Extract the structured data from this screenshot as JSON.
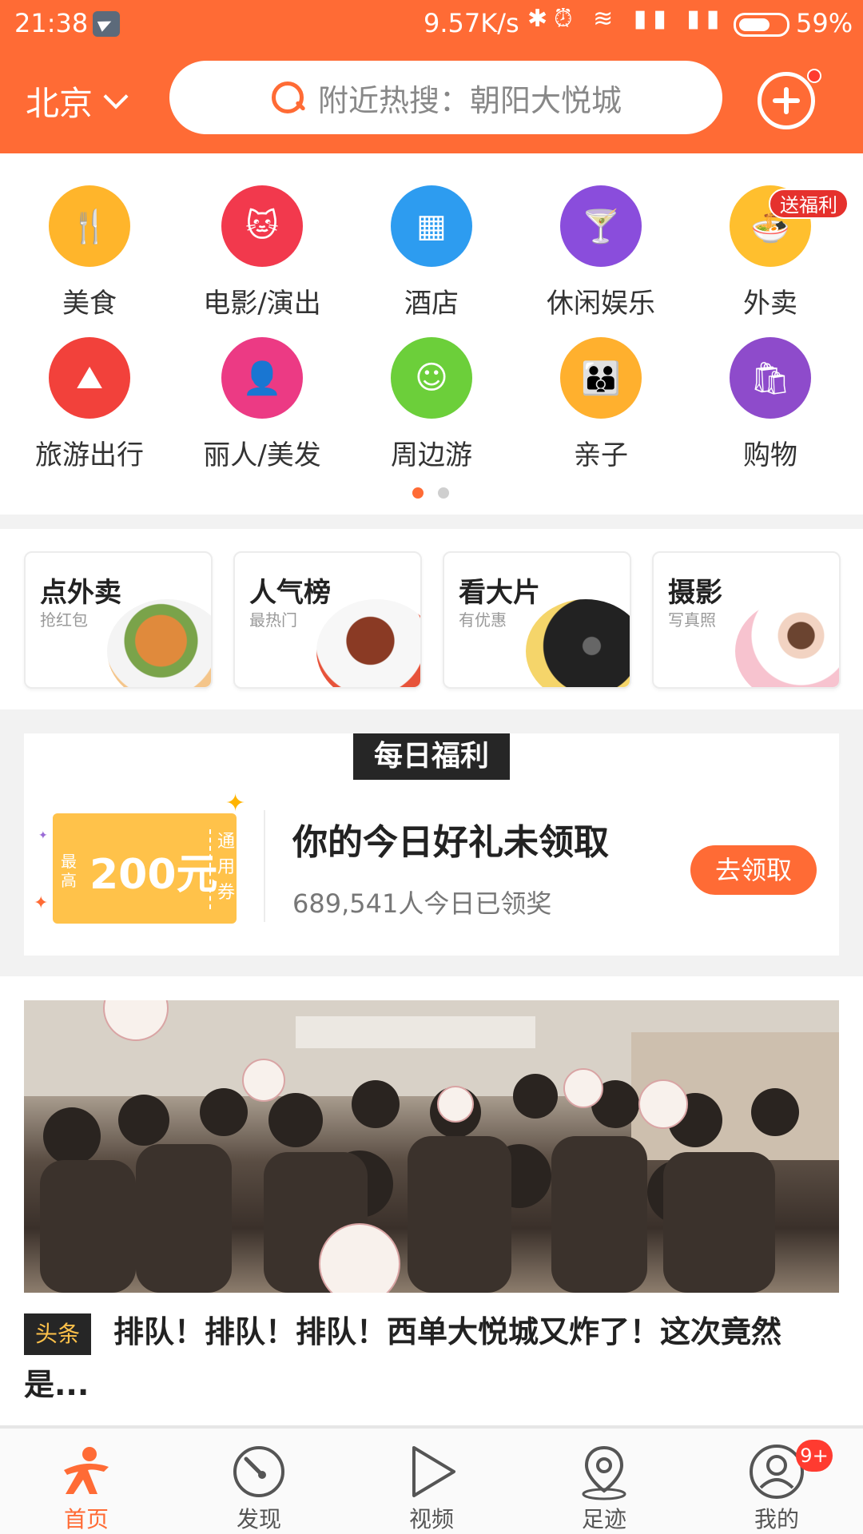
{
  "status_bar": {
    "time": "21:38",
    "net_speed": "9.57K/s",
    "battery": "59%"
  },
  "header": {
    "city": "北京",
    "search_placeholder": "附近热搜：朝阳大悦城"
  },
  "categories": [
    {
      "label": "美食",
      "icon": "food-icon",
      "color": "#ffb52b"
    },
    {
      "label": "电影/演出",
      "icon": "movie-cat-icon",
      "color": "#f2394d"
    },
    {
      "label": "酒店",
      "icon": "hotel-icon",
      "color": "#2d9cf0"
    },
    {
      "label": "休闲娱乐",
      "icon": "cocktail-icon",
      "color": "#8a4ddc"
    },
    {
      "label": "外卖",
      "icon": "takeout-icon",
      "color": "#ffbf2e",
      "badge": "送福利"
    },
    {
      "label": "旅游出行",
      "icon": "travel-icon",
      "color": "#f2413b"
    },
    {
      "label": "丽人/美发",
      "icon": "beauty-icon",
      "color": "#ec3a84"
    },
    {
      "label": "周边游",
      "icon": "mickey-icon",
      "color": "#6ccf3a"
    },
    {
      "label": "亲子",
      "icon": "parent-child-icon",
      "color": "#ffb02e"
    },
    {
      "label": "购物",
      "icon": "shopping-bag-icon",
      "color": "#8e4bcb"
    }
  ],
  "promo_cards": [
    {
      "title": "点外卖",
      "subtitle": "抢红包",
      "art_color": "#f4c58a"
    },
    {
      "title": "人气榜",
      "subtitle": "最热门",
      "art_color": "#b8563c"
    },
    {
      "title": "看大片",
      "subtitle": "有优惠",
      "art_color": "#3a3a3a"
    },
    {
      "title": "摄影",
      "subtitle": "写真照",
      "art_color": "#f7c3cf"
    }
  ],
  "daily_welfare": {
    "tag": "每日福利",
    "coupon_amount": "200元",
    "coupon_prefix": "最高",
    "coupon_side": "通用券",
    "title": "你的今日好礼未领取",
    "subtitle": "689,541人今日已领奖",
    "button": "去领取"
  },
  "news": {
    "tag": "头条",
    "title": "排队！排队！排队！西单大悦城又炸了！这次竟然是..."
  },
  "tabs": [
    {
      "label": "首页",
      "icon": "home-person-icon",
      "active": true
    },
    {
      "label": "发现",
      "icon": "discover-gauge-icon"
    },
    {
      "label": "视频",
      "icon": "video-play-icon"
    },
    {
      "label": "足迹",
      "icon": "location-pin-icon"
    },
    {
      "label": "我的",
      "icon": "user-profile-icon",
      "badge": "9+"
    }
  ],
  "colors": {
    "brand": "#ff6b35",
    "badge_red": "#e5312d"
  }
}
